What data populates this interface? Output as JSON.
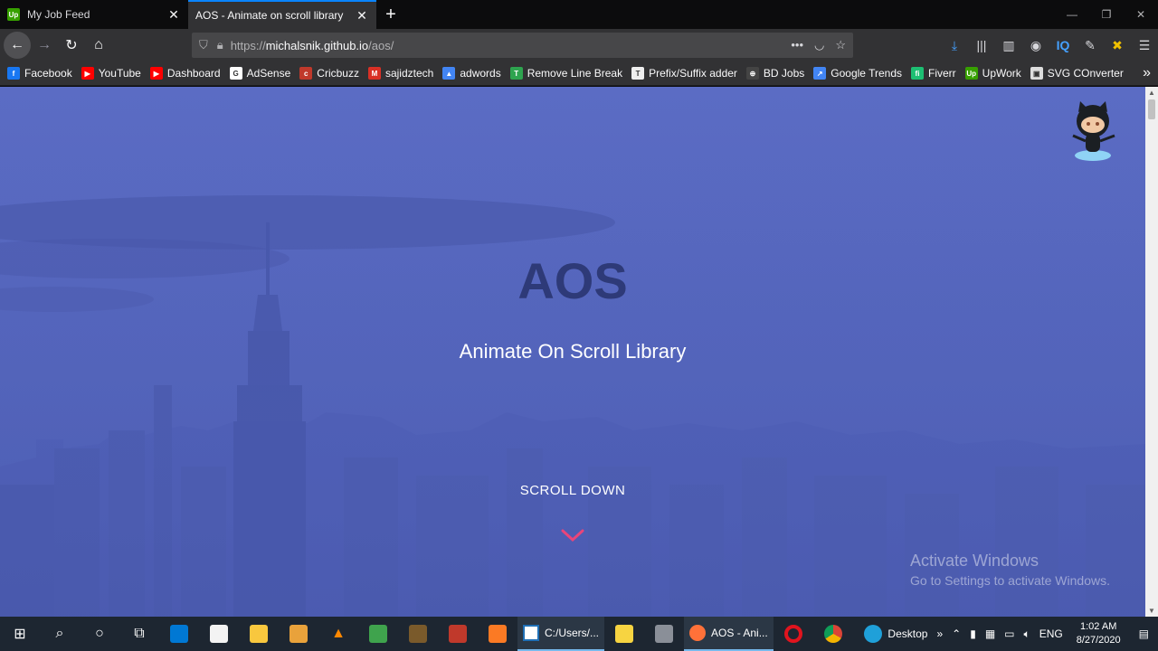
{
  "tabs": [
    {
      "title": "My Job Feed",
      "favicon": "Up",
      "favicon_color": "#37a000",
      "active": false
    },
    {
      "title": "AOS - Animate on scroll library",
      "active": true
    }
  ],
  "navbar": {
    "url_prefix": "https://",
    "url_host": "michalsnik.github.io",
    "url_path": "/aos/"
  },
  "bookmarks": [
    {
      "label": "Facebook",
      "icon": "f",
      "color": "#1877f2"
    },
    {
      "label": "YouTube",
      "icon": "▶",
      "color": "#ff0000"
    },
    {
      "label": "Dashboard",
      "icon": "▶",
      "color": "#ff0000"
    },
    {
      "label": "AdSense",
      "icon": "G",
      "color": "#ffffff"
    },
    {
      "label": "Cricbuzz",
      "icon": "c",
      "color": "#c0392b"
    },
    {
      "label": "sajidztech",
      "icon": "M",
      "color": "#d93025"
    },
    {
      "label": "adwords",
      "icon": "▲",
      "color": "#4285f4"
    },
    {
      "label": "Remove Line Break",
      "icon": "T",
      "color": "#2ea44f"
    },
    {
      "label": "Prefix/Suffix adder",
      "icon": "T",
      "color": "#eeeeee"
    },
    {
      "label": "BD Jobs",
      "icon": "⊕",
      "color": "#444444"
    },
    {
      "label": "Google Trends",
      "icon": "↗",
      "color": "#4285f4"
    },
    {
      "label": "Fiverr",
      "icon": "fi",
      "color": "#1dbf73"
    },
    {
      "label": "UpWork",
      "icon": "Up",
      "color": "#37a000"
    },
    {
      "label": "SVG COnverter",
      "icon": "▣",
      "color": "#dddddd"
    }
  ],
  "page": {
    "title": "AOS",
    "subtitle": "Animate On Scroll Library",
    "scroll_label": "SCROLL DOWN",
    "watermark_title": "Activate Windows",
    "watermark_sub": "Go to Settings to activate Windows."
  },
  "taskbar": {
    "explorer_label": "C:/Users/...",
    "firefox_label": "AOS - Ani...",
    "desktop_label": "Desktop",
    "language": "ENG",
    "time": "1:02 AM",
    "date": "8/27/2020"
  },
  "colors": {
    "accent": "#0a84ff",
    "hero_bg": "#5566bd",
    "hero_title": "#2e3a78",
    "chevron": "#e9457a"
  }
}
